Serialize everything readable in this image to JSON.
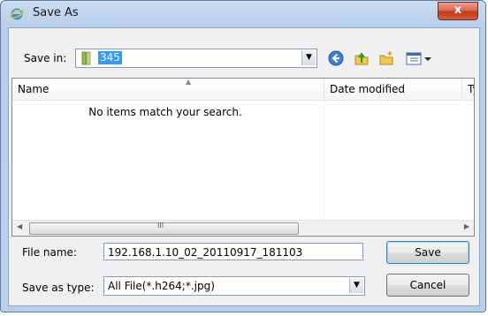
{
  "window": {
    "title": "Save As",
    "close_label": "x"
  },
  "toolbar": {
    "save_in_label": "Save in:",
    "save_in_value": "345",
    "icons": [
      "back-icon",
      "up-folder-icon",
      "new-folder-icon",
      "views-menu-icon"
    ]
  },
  "list": {
    "columns": [
      "Name",
      "Date modified",
      "Ty"
    ],
    "empty_message": "No items match your search.",
    "scroll_grip": "III"
  },
  "form": {
    "file_name_label": "File name:",
    "file_name_value": "192.168.1.10_02_20110917_181103",
    "save_as_type_label": "Save as type:",
    "save_as_type_value": "All File(*.h264;*.jpg)"
  },
  "buttons": {
    "save": "Save",
    "cancel": "Cancel"
  },
  "colors": {
    "titlebar": "#b9d0eb",
    "close": "#c94a2e",
    "selection": "#3399ff"
  }
}
